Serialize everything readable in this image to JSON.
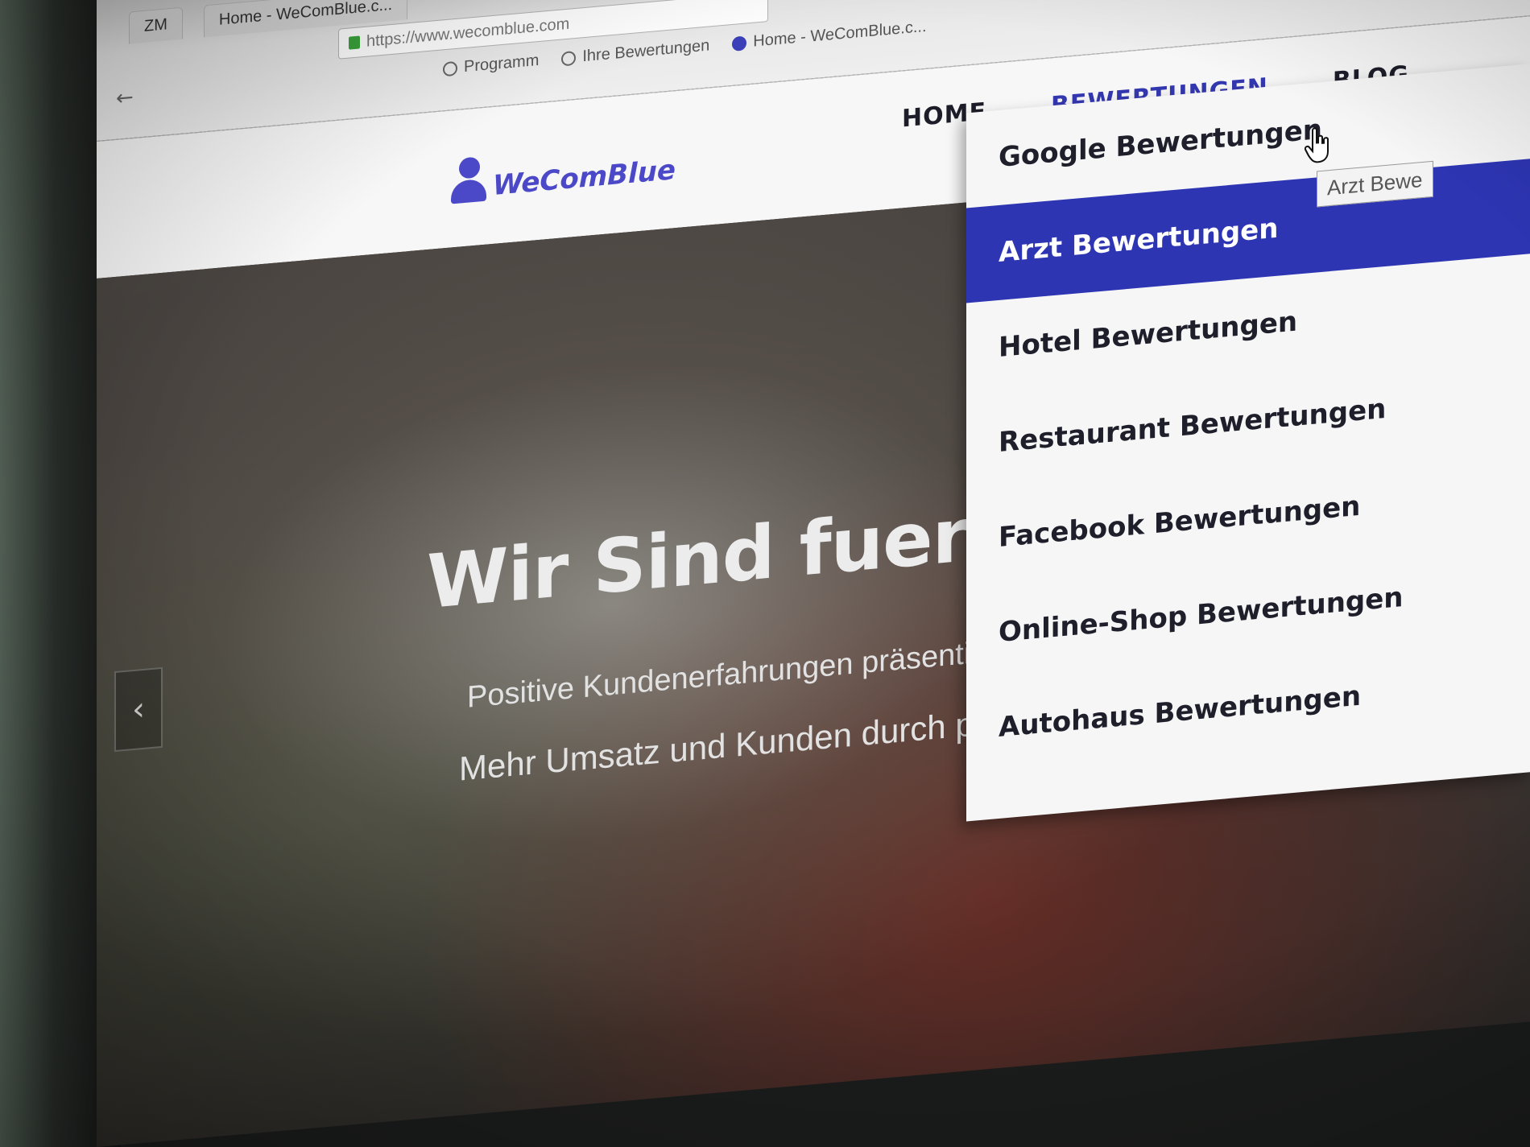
{
  "browser": {
    "tabs": [
      "ZM",
      "Home - WeComBlue.c..."
    ],
    "url": "https://www.wecomblue.com",
    "bookmarks": [
      "Programm",
      "Ihre Bewertungen",
      "Home - WeComBlue.c..."
    ],
    "nav": {
      "back": "←",
      "forward": "→",
      "reload": "↻"
    }
  },
  "site": {
    "logo_text": "WeComBlue",
    "nav": [
      {
        "label": "HOME",
        "active": false
      },
      {
        "label": "BEWERTUNGEN",
        "active": true
      },
      {
        "label": "BLOG",
        "active": false
      }
    ]
  },
  "hero": {
    "title": "Wir Sind fuer Sie d",
    "subtitle_1": "Positive Kundenerfahrungen präsentieren",
    "subtitle_2": "Mehr Umsatz und Kunden durch positive Bewertungen",
    "prev_label": "‹"
  },
  "dropdown": {
    "items": [
      {
        "label": "Google Bewertungen",
        "active": false
      },
      {
        "label": "Arzt Bewertungen",
        "active": true
      },
      {
        "label": "Hotel Bewertungen",
        "active": false
      },
      {
        "label": "Restaurant Bewertungen",
        "active": false
      },
      {
        "label": "Facebook Bewertungen",
        "active": false
      },
      {
        "label": "Online-Shop Bewertungen",
        "active": false
      },
      {
        "label": "Autohaus Bewertungen",
        "active": false
      }
    ],
    "tooltip": "Arzt Bewe"
  },
  "colors": {
    "brand": "#3438b0",
    "active_item_bg": "#2d35b3"
  }
}
